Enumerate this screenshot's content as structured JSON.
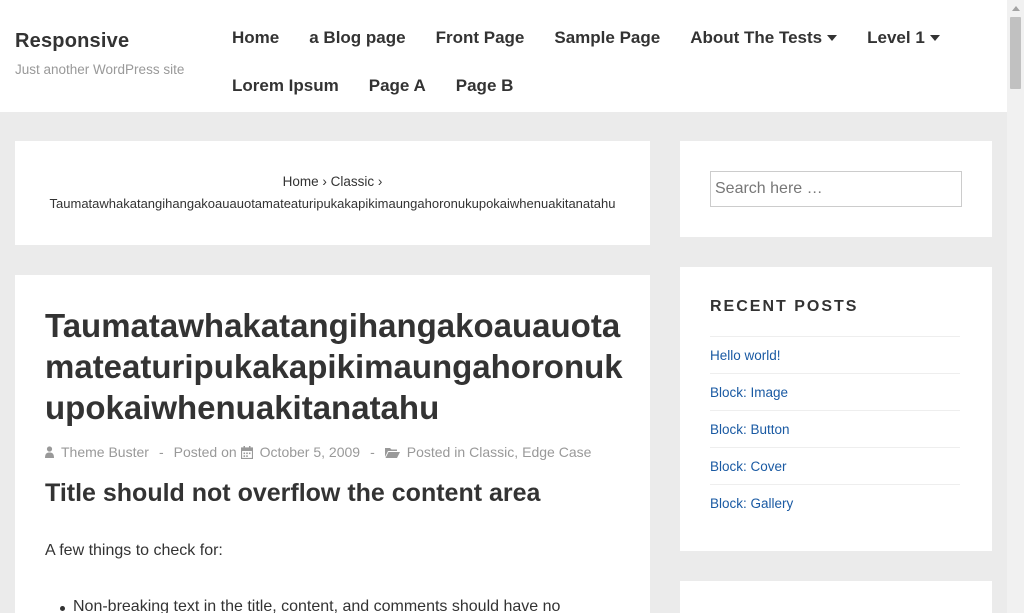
{
  "site": {
    "title": "Responsive",
    "description": "Just another WordPress site"
  },
  "nav": {
    "row1": [
      {
        "label": "Home",
        "dropdown": false
      },
      {
        "label": "a Blog page",
        "dropdown": false
      },
      {
        "label": "Front Page",
        "dropdown": false
      },
      {
        "label": "Sample Page",
        "dropdown": false
      },
      {
        "label": "About The Tests",
        "dropdown": true
      },
      {
        "label": "Level 1",
        "dropdown": true
      }
    ],
    "row2": [
      {
        "label": "Lorem Ipsum"
      },
      {
        "label": "Page A"
      },
      {
        "label": "Page B"
      }
    ]
  },
  "breadcrumb": {
    "home": "Home",
    "sep1": "›",
    "category": "Classic",
    "sep2": "›",
    "current": "Taumatawhakatangihangakoauauotamateaturipukakapikimaungahoronukupokaiwhenuakitanatahu"
  },
  "post": {
    "title": "Taumatawhakatangihangakoauauotamateaturipukakapikimaungahoronukupokaiwhenuakitanatahu",
    "meta": {
      "author": "Theme Buster",
      "posted_on_label": "Posted on",
      "date": "October 5, 2009",
      "posted_in_label": "Posted in",
      "category1": "Classic",
      "category_sep": ",",
      "category2": "Edge Case",
      "sep": "-"
    },
    "subheading": "Title should not overflow the content area",
    "paragraph": "A few things to check for:",
    "list_item": "Non-breaking text in the title, content, and comments should have no"
  },
  "search": {
    "placeholder": "Search here …"
  },
  "recent_posts": {
    "heading": "RECENT POSTS",
    "items": [
      "Hello world!",
      "Block: Image",
      "Block: Button",
      "Block: Cover",
      "Block: Gallery"
    ]
  },
  "colors": {
    "background": "#ebebeb",
    "link": "#1a5aa3",
    "meta": "#999999"
  }
}
